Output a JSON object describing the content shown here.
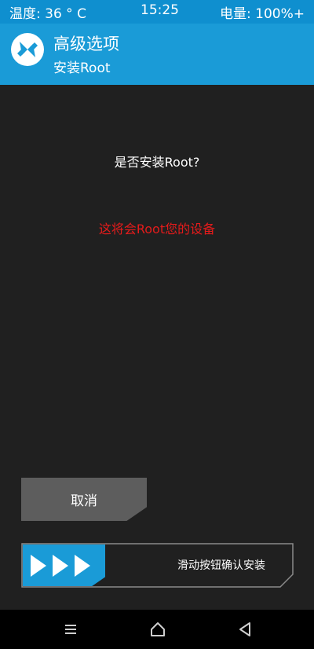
{
  "status_bar": {
    "temperature": "温度: 36 ° C",
    "time": "15:25",
    "battery": "电量: 100%+"
  },
  "header": {
    "logo_icon": "twrp-logo-icon",
    "title": "高级选项",
    "subtitle": "安装Root"
  },
  "content": {
    "question": "是否安装Root?",
    "warning": "这将会Root您的设备"
  },
  "actions": {
    "cancel_label": "取消",
    "slider_label": "滑动按钮确认安装",
    "slider_icon": "triple-arrow-icon"
  },
  "nav_bar": {
    "menu_icon": "menu-icon",
    "home_icon": "home-icon",
    "back_icon": "back-icon"
  },
  "colors": {
    "accent": "#1a9bd7",
    "status_bar": "#0f8fcf",
    "background": "#202020",
    "warning": "#e41b1b",
    "button": "#5d5d5d"
  }
}
